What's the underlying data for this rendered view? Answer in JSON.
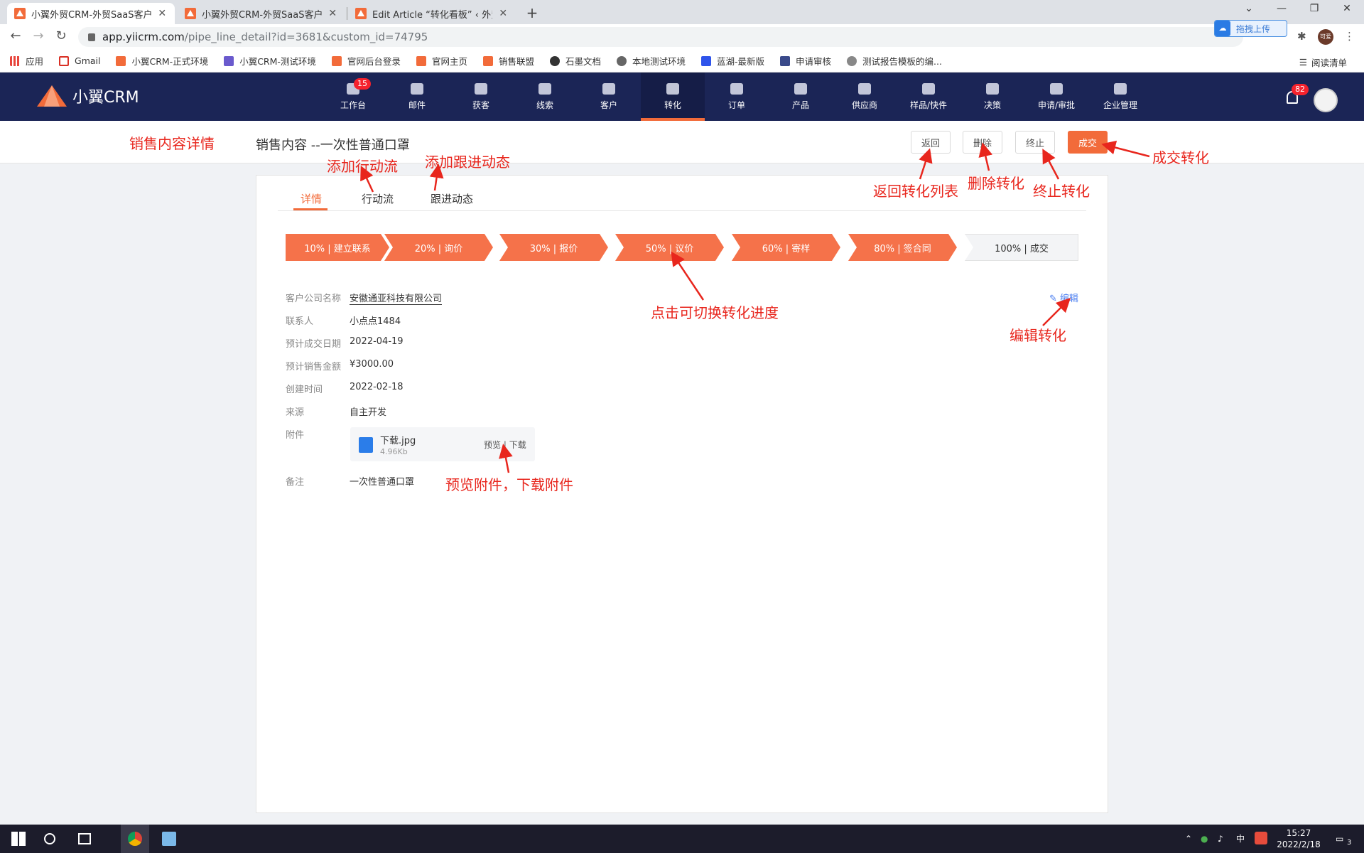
{
  "browser": {
    "tabs": [
      {
        "title": "小翼外贸CRM-外贸SaaS客户管理"
      },
      {
        "title": "小翼外贸CRM-外贸SaaS客户管理"
      },
      {
        "title": "Edit Article “转化看板” ‹ 外贸CRM"
      }
    ],
    "url_domain": "app.yiicrm.com",
    "url_path": "/pipe_line_detail?id=3681&custom_id=74795",
    "upload_label": "拖拽上传",
    "profile_label": "可爱",
    "bookmarks": [
      "应用",
      "Gmail",
      "小翼CRM-正式环境",
      "小翼CRM-测试环境",
      "官网后台登录",
      "官网主页",
      "销售联盟",
      "石墨文档",
      "本地测试环境",
      "蓝湖-最新版",
      "申请审核",
      "测试报告模板的编..."
    ],
    "reading_list": "阅读清单"
  },
  "app": {
    "logo_text": "小翼CRM",
    "nav": [
      {
        "label": "工作台",
        "badge": "15"
      },
      {
        "label": "邮件"
      },
      {
        "label": "获客"
      },
      {
        "label": "线索"
      },
      {
        "label": "客户"
      },
      {
        "label": "转化"
      },
      {
        "label": "订单"
      },
      {
        "label": "产品"
      },
      {
        "label": "供应商"
      },
      {
        "label": "样品/快件"
      },
      {
        "label": "决策"
      },
      {
        "label": "申请/审批"
      },
      {
        "label": "企业管理"
      }
    ],
    "active_nav": "转化",
    "notification_count": "82",
    "accent": "#f26b3a",
    "header_bg": "#1b2556"
  },
  "page": {
    "title": "销售内容 --一次性普通口罩",
    "buttons": {
      "back": "返回",
      "delete": "删除",
      "stop": "终止",
      "deal": "成交"
    },
    "tabs": [
      "详情",
      "行动流",
      "跟进动态"
    ],
    "stages": [
      "10% | 建立联系",
      "20% | 询价",
      "30% | 报价",
      "50% | 议价",
      "60% | 寄样",
      "80% | 签合同",
      "100% | 成交"
    ],
    "fields": [
      {
        "label": "客户公司名称",
        "value": "安徽通亚科技有限公司"
      },
      {
        "label": "联系人",
        "value": "小点点1484"
      },
      {
        "label": "预计成交日期",
        "value": "2022-04-19"
      },
      {
        "label": "预计销售金额",
        "value": "¥3000.00"
      },
      {
        "label": "创建时间",
        "value": "2022-02-18"
      },
      {
        "label": "来源",
        "value": "自主开发"
      }
    ],
    "attachment_label": "附件",
    "attachment": {
      "name": "下载.jpg",
      "size": "4.96Kb",
      "preview": "预览",
      "download": "下载"
    },
    "remark_label": "备注",
    "remark": "一次性普通口罩",
    "edit_label": "编辑"
  },
  "annotations": {
    "sales_detail": "销售内容详情",
    "add_action": "添加行动流",
    "add_follow": "添加跟进动态",
    "back_list": "返回转化列表",
    "delete_conv": "删除转化",
    "stop_conv": "终止转化",
    "deal_conv": "成交转化",
    "switch_progress": "点击可切换转化进度",
    "edit_conv": "编辑转化",
    "preview_download": "预览附件，下载附件"
  },
  "taskbar": {
    "ime": "中",
    "time": "15:27",
    "date": "2022/2/18",
    "notif": "3"
  }
}
